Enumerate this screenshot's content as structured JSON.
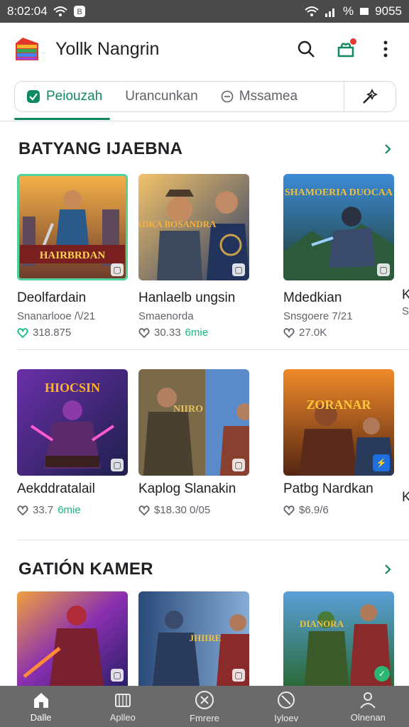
{
  "status": {
    "time": "8:02:04",
    "battery": "9055"
  },
  "app": {
    "title": "Yollk Nangrin"
  },
  "tabs": [
    {
      "label": "Peiouzah"
    },
    {
      "label": "Urancunkan"
    },
    {
      "label": "Mssamea"
    }
  ],
  "sections": [
    {
      "title": "BATYANG IJAEBNA",
      "rows": [
        [
          {
            "name": "Deolfardain",
            "sub": "Snanarlooe /\\/21",
            "meta": "318.875",
            "art": "HAIRBRDAN"
          },
          {
            "name": "Hanlaelb ungsin",
            "sub": "Smaenorda",
            "meta": "30.33",
            "meta_accent": "6mie",
            "art": "IADKA BOSANDRA"
          },
          {
            "name": "Mdedkian",
            "sub": "Snsgoere 7/21",
            "meta": "27.0K",
            "art": "SHAMOERIA DUOCAA"
          }
        ],
        [
          {
            "name": "Aekddratalail",
            "meta": "33.7",
            "meta_accent": "6mie",
            "art": "HIOCSIN"
          },
          {
            "name": "Kaplog Slanakin",
            "meta": "$18.30 0/05",
            "art": "NIIRO"
          },
          {
            "name": "Patbg Nardkan",
            "meta": "$6.9/6",
            "art": "ZORANAR"
          }
        ]
      ]
    },
    {
      "title": "GATIÓN KAMER",
      "rows": [
        [
          {
            "art": ""
          },
          {
            "art": "JHIIRE"
          },
          {
            "art": "DIANORA"
          }
        ]
      ]
    }
  ],
  "edge": {
    "row1": "K",
    "row1_sub": "S",
    "row2": "K"
  },
  "bottom_nav": [
    {
      "label": "Dalle",
      "icon": "home-icon"
    },
    {
      "label": "Aplleo",
      "icon": "apps-icon"
    },
    {
      "label": "Fmrere",
      "icon": "games-icon"
    },
    {
      "label": "Iyloev",
      "icon": "library-icon"
    },
    {
      "label": "Olnenan",
      "icon": "profile-icon"
    }
  ]
}
